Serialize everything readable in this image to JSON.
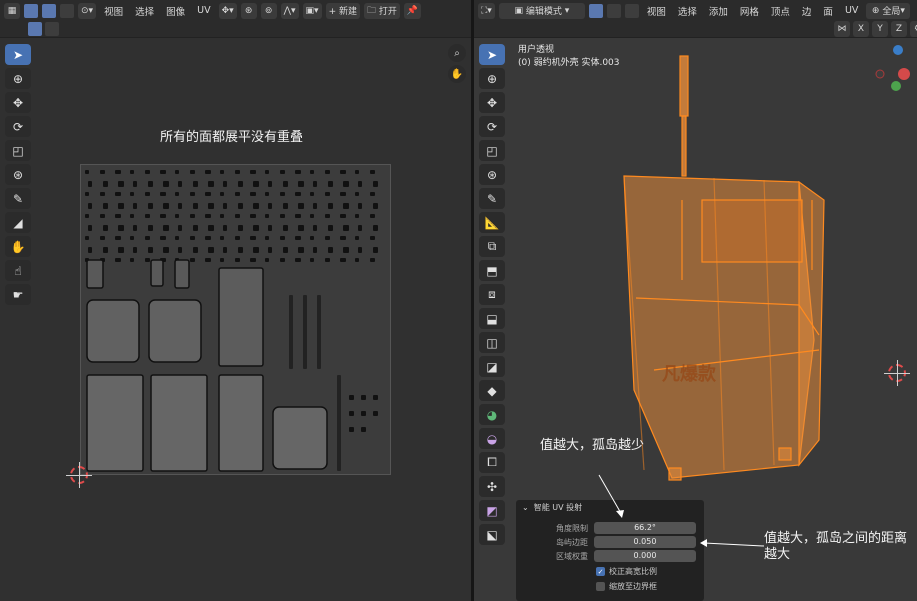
{
  "uv_editor": {
    "menus": [
      "视图",
      "选择",
      "图像",
      "UV"
    ],
    "new_label": "+ 新建",
    "open_label": "打开",
    "caption": "所有的面都展平没有重叠"
  },
  "viewport": {
    "mode_label": "编辑模式",
    "menus": [
      "视图",
      "选择",
      "添加",
      "网格",
      "顶点",
      "边",
      "面",
      "UV"
    ],
    "transform_label": "全局",
    "axes": [
      "X",
      "Y",
      "Z"
    ],
    "view_label": "用户透视",
    "object_label": "(0) 弱约机外壳  实体.003",
    "model_text": "凡爆款"
  },
  "operator_panel": {
    "title": "智能 UV 投射",
    "fields": [
      {
        "label": "角度限制",
        "value": "66.2°"
      },
      {
        "label": "岛屿边距",
        "value": "0.050"
      },
      {
        "label": "区域权重",
        "value": "0.000"
      }
    ],
    "checks": [
      {
        "label": "校正高宽比例",
        "checked": true
      },
      {
        "label": "缩放至边界框",
        "checked": false
      }
    ]
  },
  "annotations": {
    "angle_note": "值越大，孤岛越少",
    "margin_note": "值越大，孤岛之间的距离越大"
  },
  "colors": {
    "accent": "#4772b3",
    "selection_orange": "#ff8a1f",
    "background": "#303030"
  }
}
